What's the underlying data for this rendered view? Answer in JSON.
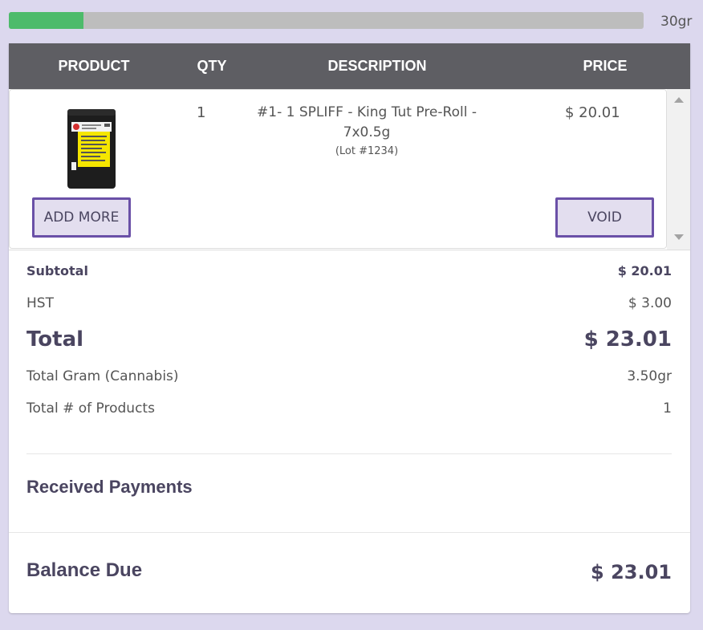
{
  "cannabis_limit": {
    "fill_fraction": 0.117,
    "label": "30gr",
    "fill_color": "#4dbb6b"
  },
  "table": {
    "headers": [
      "PRODUCT",
      "QTY",
      "DESCRIPTION",
      "PRICE"
    ]
  },
  "cart_items": [
    {
      "image_icon": "product-pouch-icon",
      "qty": "1",
      "description_line1": "#1- 1 SPLIFF - King Tut Pre-Roll -",
      "description_line2": "7x0.5g",
      "lot": "(Lot #1234)",
      "price": "$ 20.01",
      "add_more_label": "ADD MORE",
      "void_label": "VOID"
    }
  ],
  "totals": {
    "subtotal_label": "Subtotal",
    "subtotal_value": "$ 20.01",
    "hst_label": "HST",
    "hst_value": "$ 3.00",
    "total_label": "Total",
    "total_value": "$ 23.01",
    "total_gram_label": "Total Gram (Cannabis)",
    "total_gram_value": "3.50gr",
    "total_products_label": "Total # of Products",
    "total_products_value": "1"
  },
  "payments": {
    "title": "Received Payments"
  },
  "balance": {
    "label": "Balance Due",
    "value": "$ 23.01"
  },
  "colors": {
    "background": "#dcd8ee",
    "header": "#5e5e63",
    "accent": "#6a50a7",
    "button_bg": "#e3deef",
    "text": "#4a4560"
  }
}
